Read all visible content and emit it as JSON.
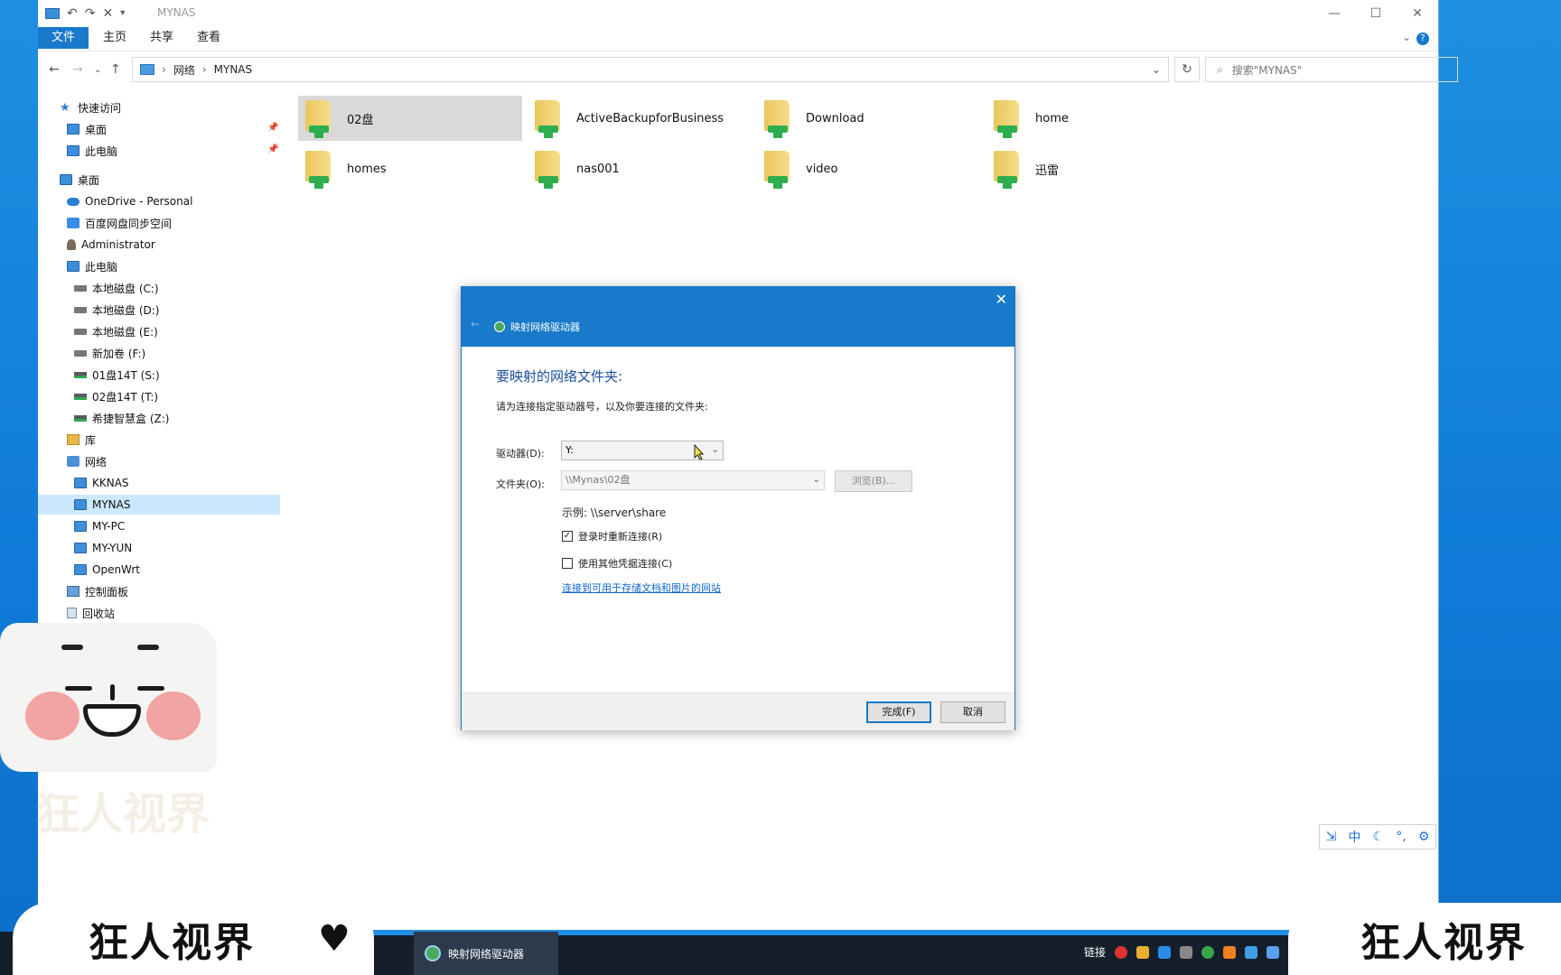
{
  "window": {
    "title": "MYNAS"
  },
  "ribbon": {
    "tabs": [
      "文件",
      "主页",
      "共享",
      "查看"
    ]
  },
  "address": {
    "crumbs": [
      "网络",
      "MYNAS"
    ],
    "search_placeholder": "搜索\"MYNAS\""
  },
  "sidebar": {
    "items": [
      {
        "label": "快速访问",
        "icon": "star-icon"
      },
      {
        "label": "桌面",
        "icon": "desktop-icon"
      },
      {
        "label": "此电脑",
        "icon": "computer-icon"
      },
      {
        "label": "桌面",
        "icon": "desktop-icon"
      },
      {
        "label": "OneDrive - Personal",
        "icon": "cloud-icon"
      },
      {
        "label": "百度网盘同步空间",
        "icon": "baidu-icon"
      },
      {
        "label": "Administrator",
        "icon": "user-icon"
      },
      {
        "label": "此电脑",
        "icon": "computer-icon"
      },
      {
        "label": "本地磁盘 (C:)",
        "icon": "drive-icon"
      },
      {
        "label": "本地磁盘 (D:)",
        "icon": "drive-icon"
      },
      {
        "label": "本地磁盘 (E:)",
        "icon": "drive-icon"
      },
      {
        "label": "新加卷 (F:)",
        "icon": "drive-icon"
      },
      {
        "label": "01盘14T (S:)",
        "icon": "network-drive-icon"
      },
      {
        "label": "02盘14T (T:)",
        "icon": "network-drive-icon"
      },
      {
        "label": "希捷智慧盒 (Z:)",
        "icon": "network-drive-icon"
      },
      {
        "label": "库",
        "icon": "library-icon"
      },
      {
        "label": "网络",
        "icon": "network-icon"
      },
      {
        "label": "KKNAS",
        "icon": "computer-icon"
      },
      {
        "label": "MYNAS",
        "icon": "computer-icon"
      },
      {
        "label": "MY-PC",
        "icon": "computer-icon"
      },
      {
        "label": "MY-YUN",
        "icon": "computer-icon"
      },
      {
        "label": "OpenWrt",
        "icon": "computer-icon"
      },
      {
        "label": "控制面板",
        "icon": "control-panel-icon"
      },
      {
        "label": "回收站",
        "icon": "recycle-bin-icon"
      }
    ]
  },
  "folders": [
    "02盘",
    "ActiveBackupforBusiness",
    "Download",
    "home",
    "homes",
    "nas001",
    "video",
    "迅雷"
  ],
  "dialog": {
    "title": "映射网络驱动器",
    "heading": "要映射的网络文件夹:",
    "subtitle": "请为连接指定驱动器号，以及你要连接的文件夹:",
    "drive_label": "驱动器(D):",
    "drive_value": "Y:",
    "folder_label": "文件夹(O):",
    "folder_value": "\\\\Mynas\\02盘",
    "browse_label": "浏览(B)...",
    "example": "示例: \\\\server\\share",
    "reconnect_label": "登录时重新连接(R)",
    "reconnect_checked": true,
    "creds_label": "使用其他凭据连接(C)",
    "creds_checked": false,
    "link": "连接到可用于存储文档和图片的网站",
    "finish_label": "完成(F)",
    "cancel_label": "取消"
  },
  "taskbar": {
    "active_app": "映射网络驱动器",
    "tray_text": "链接"
  },
  "ime": {
    "mode": "中"
  },
  "watermark": {
    "text": "狂人视界"
  }
}
